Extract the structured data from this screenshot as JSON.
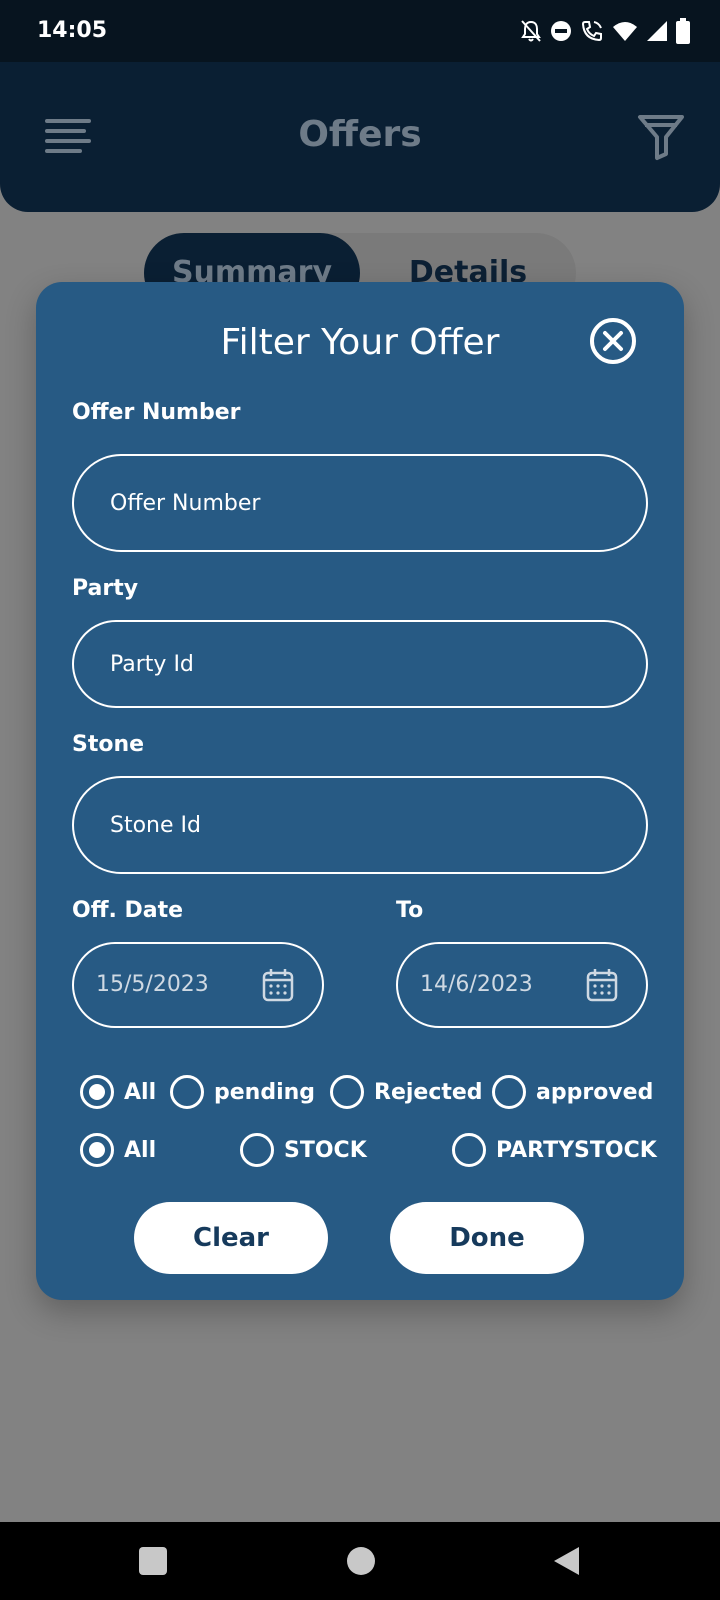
{
  "status_bar": {
    "time": "14:05",
    "icons": [
      "notifications-off-icon",
      "do-not-disturb-icon",
      "wifi-call-icon",
      "wifi-icon",
      "signal-icon",
      "battery-icon"
    ]
  },
  "header": {
    "title": "Offers",
    "menu_icon": "menu-icon",
    "filter_icon": "filter-icon"
  },
  "tabs": [
    {
      "label": "Summary",
      "active": true
    },
    {
      "label": "Details",
      "active": false
    }
  ],
  "filter_modal": {
    "title": "Filter Your Offer",
    "close_icon": "close-icon",
    "offer_number": {
      "label": "Offer Number",
      "placeholder": "Offer Number",
      "value": ""
    },
    "party": {
      "label": "Party",
      "placeholder": "Party Id",
      "value": ""
    },
    "stone": {
      "label": "Stone",
      "placeholder": "Stone Id",
      "value": ""
    },
    "offer_date": {
      "label": "Off. Date",
      "value": "15/5/2023"
    },
    "to_date": {
      "label": "To",
      "value": "14/6/2023"
    },
    "status_options": [
      {
        "label": "All",
        "selected": true
      },
      {
        "label": "pending",
        "selected": false
      },
      {
        "label": "Rejected",
        "selected": false
      },
      {
        "label": "approved",
        "selected": false
      }
    ],
    "stock_options": [
      {
        "label": "All",
        "selected": true
      },
      {
        "label": "STOCK",
        "selected": false
      },
      {
        "label": "PARTYSTOCK",
        "selected": false
      }
    ],
    "clear_label": "Clear",
    "done_label": "Done"
  },
  "colors": {
    "modal_background": "#275a84",
    "header_background": "#0a1f33",
    "overlay": "#828282",
    "button_text": "#163a5c"
  }
}
